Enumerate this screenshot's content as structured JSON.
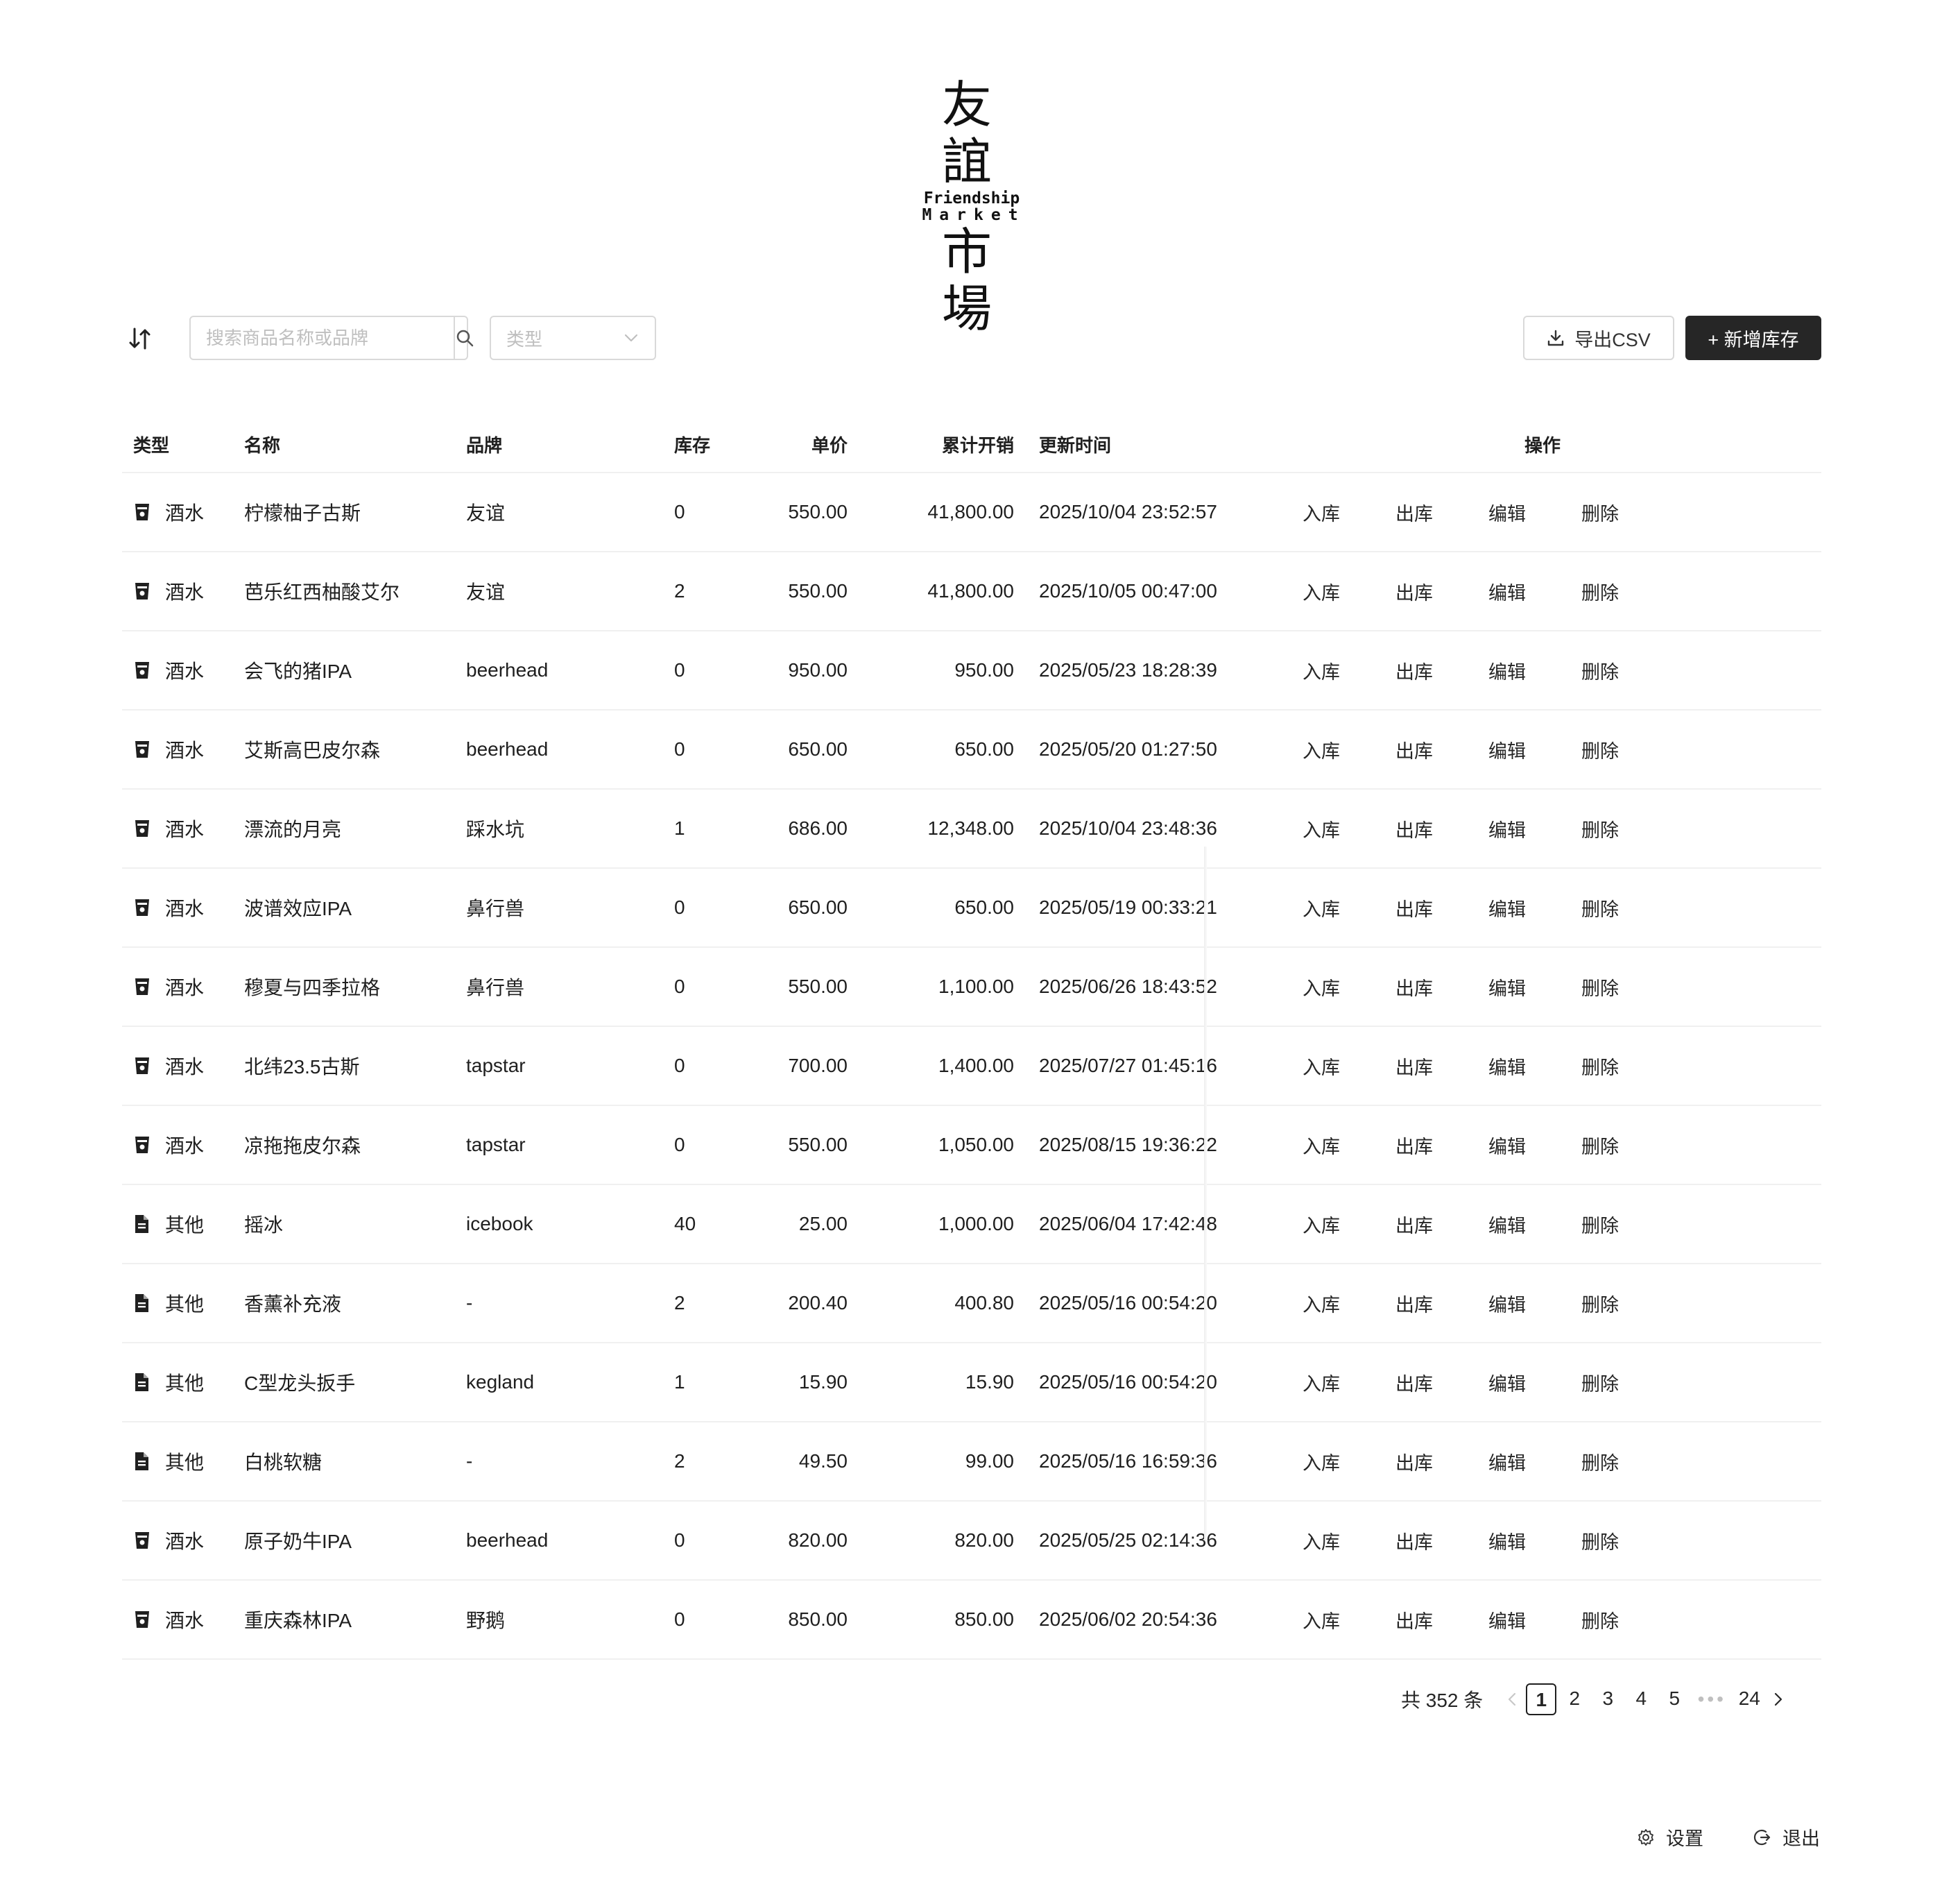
{
  "logo": {
    "line1": "友誼",
    "en1": "Friendship",
    "en2": "Market",
    "line2": "市場"
  },
  "toolbar": {
    "search_placeholder": "搜索商品名称或品牌",
    "type_placeholder": "类型",
    "export_label": "导出CSV",
    "add_label": "+ 新增库存"
  },
  "table": {
    "headers": {
      "type": "类型",
      "name": "名称",
      "brand": "品牌",
      "stock": "库存",
      "price": "单价",
      "total": "累计开销",
      "time": "更新时间",
      "ops": "操作"
    },
    "actions": [
      "入库",
      "出库",
      "编辑",
      "删除"
    ],
    "rows": [
      {
        "icon": "cup-icon",
        "type": "酒水",
        "name": "柠檬柚子古斯",
        "brand": "友谊",
        "stock": "0",
        "price": "550.00",
        "total": "41,800.00",
        "time": "2025/10/04 23:52:57"
      },
      {
        "icon": "cup-icon",
        "type": "酒水",
        "name": "芭乐红西柚酸艾尔",
        "brand": "友谊",
        "stock": "2",
        "price": "550.00",
        "total": "41,800.00",
        "time": "2025/10/05 00:47:00"
      },
      {
        "icon": "cup-icon",
        "type": "酒水",
        "name": "会飞的猪IPA",
        "brand": "beerhead",
        "stock": "0",
        "price": "950.00",
        "total": "950.00",
        "time": "2025/05/23 18:28:39"
      },
      {
        "icon": "cup-icon",
        "type": "酒水",
        "name": "艾斯高巴皮尔森",
        "brand": "beerhead",
        "stock": "0",
        "price": "650.00",
        "total": "650.00",
        "time": "2025/05/20 01:27:50"
      },
      {
        "icon": "cup-icon",
        "type": "酒水",
        "name": "漂流的月亮",
        "brand": "踩水坑",
        "stock": "1",
        "price": "686.00",
        "total": "12,348.00",
        "time": "2025/10/04 23:48:36"
      },
      {
        "icon": "cup-icon",
        "type": "酒水",
        "name": "波谱效应IPA",
        "brand": "鼻行兽",
        "stock": "0",
        "price": "650.00",
        "total": "650.00",
        "time": "2025/05/19 00:33:21"
      },
      {
        "icon": "cup-icon",
        "type": "酒水",
        "name": "穆夏与四季拉格",
        "brand": "鼻行兽",
        "stock": "0",
        "price": "550.00",
        "total": "1,100.00",
        "time": "2025/06/26 18:43:52"
      },
      {
        "icon": "cup-icon",
        "type": "酒水",
        "name": "北纬23.5古斯",
        "brand": "tapstar",
        "stock": "0",
        "price": "700.00",
        "total": "1,400.00",
        "time": "2025/07/27 01:45:16"
      },
      {
        "icon": "cup-icon",
        "type": "酒水",
        "name": "凉拖拖皮尔森",
        "brand": "tapstar",
        "stock": "0",
        "price": "550.00",
        "total": "1,050.00",
        "time": "2025/08/15 19:36:22"
      },
      {
        "icon": "file-icon",
        "type": "其他",
        "name": "摇冰",
        "brand": "icebook",
        "stock": "40",
        "price": "25.00",
        "total": "1,000.00",
        "time": "2025/06/04 17:42:48"
      },
      {
        "icon": "file-icon",
        "type": "其他",
        "name": "香薰补充液",
        "brand": "-",
        "stock": "2",
        "price": "200.40",
        "total": "400.80",
        "time": "2025/05/16 00:54:20"
      },
      {
        "icon": "file-icon",
        "type": "其他",
        "name": "C型龙头扳手",
        "brand": "kegland",
        "stock": "1",
        "price": "15.90",
        "total": "15.90",
        "time": "2025/05/16 00:54:20"
      },
      {
        "icon": "file-icon",
        "type": "其他",
        "name": "白桃软糖",
        "brand": "-",
        "stock": "2",
        "price": "49.50",
        "total": "99.00",
        "time": "2025/05/16 16:59:36"
      },
      {
        "icon": "cup-icon",
        "type": "酒水",
        "name": "原子奶牛IPA",
        "brand": "beerhead",
        "stock": "0",
        "price": "820.00",
        "total": "820.00",
        "time": "2025/05/25 02:14:36"
      },
      {
        "icon": "cup-icon",
        "type": "酒水",
        "name": "重庆森林IPA",
        "brand": "野鹅",
        "stock": "0",
        "price": "850.00",
        "total": "850.00",
        "time": "2025/06/02 20:54:36"
      }
    ]
  },
  "pagination": {
    "total_text": "共 352 条",
    "pages": [
      "1",
      "2",
      "3",
      "4",
      "5"
    ],
    "current": "1",
    "ellipsis": "•••",
    "last_page": "24"
  },
  "footer": {
    "settings_label": "设置",
    "logout_label": "退出"
  }
}
